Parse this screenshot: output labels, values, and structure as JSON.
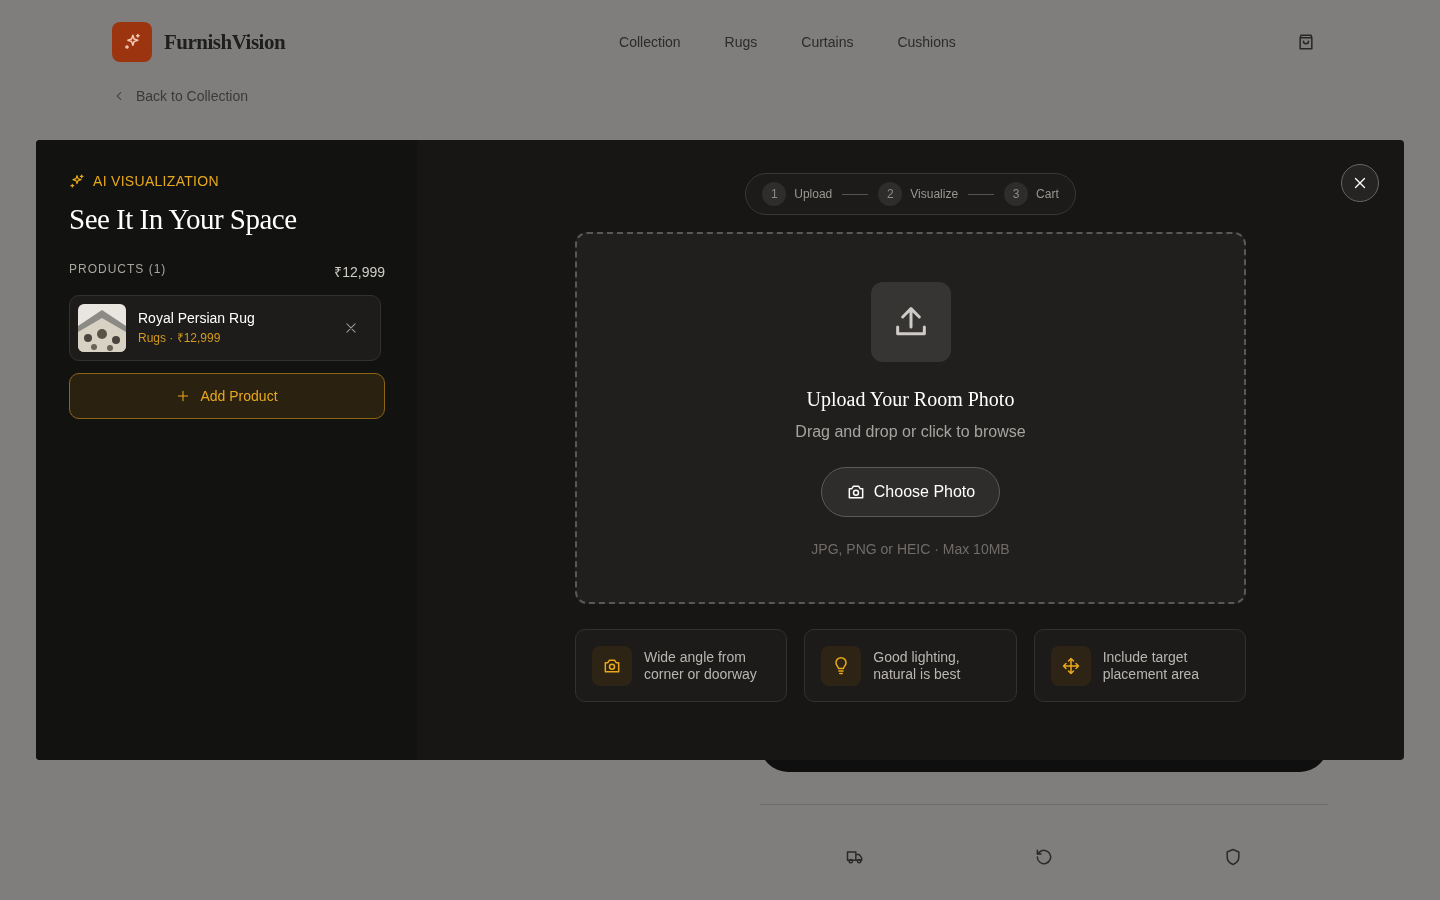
{
  "header": {
    "brand": "FurnishVision",
    "nav": [
      {
        "label": "Collection"
      },
      {
        "label": "Rugs"
      },
      {
        "label": "Curtains"
      },
      {
        "label": "Cushions"
      }
    ]
  },
  "breadcrumb": "Back to Collection",
  "modal": {
    "eyebrow": "AI VISUALIZATION",
    "title": "See It In Your Space",
    "products_label": "PRODUCTS (1)",
    "total": "₹12,999",
    "products": [
      {
        "name": "Royal Persian Rug",
        "meta": "Rugs · ₹12,999"
      }
    ],
    "add_button": "Add Product",
    "steps": [
      {
        "number": "1",
        "label": "Upload"
      },
      {
        "number": "2",
        "label": "Visualize"
      },
      {
        "number": "3",
        "label": "Cart"
      }
    ],
    "upload": {
      "title": "Upload Your Room Photo",
      "subtitle": "Drag and drop or click to browse",
      "button": "Choose Photo",
      "hint": "JPG, PNG or HEIC · Max 10MB"
    },
    "tips": [
      {
        "kind": "camera",
        "text": "Wide angle from corner or doorway"
      },
      {
        "kind": "bulb",
        "text": "Good lighting, natural is best"
      },
      {
        "kind": "move",
        "text": "Include target placement area"
      }
    ]
  },
  "features": [
    {
      "kind": "truck"
    },
    {
      "kind": "undo"
    },
    {
      "kind": "shield"
    }
  ]
}
